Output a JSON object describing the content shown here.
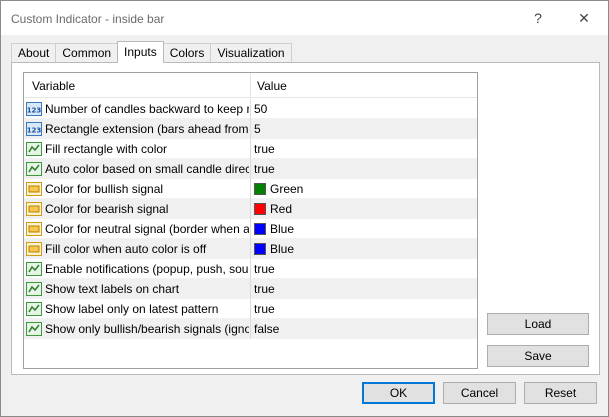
{
  "window": {
    "title": "Custom Indicator - inside bar",
    "help_glyph": "?",
    "close_glyph": "✕"
  },
  "tabs": [
    {
      "label": "About"
    },
    {
      "label": "Common"
    },
    {
      "label": "Inputs",
      "active": true
    },
    {
      "label": "Colors"
    },
    {
      "label": "Visualization"
    }
  ],
  "grid": {
    "columns": {
      "variable": "Variable",
      "value": "Value"
    },
    "rows": [
      {
        "icon": "number-icon",
        "name": "Number of candles backward to keep re...",
        "value": "50"
      },
      {
        "icon": "number-icon",
        "name": "Rectangle extension (bars ahead from bi...",
        "value": "5"
      },
      {
        "icon": "boolean-icon",
        "name": "Fill rectangle with color",
        "value": "true"
      },
      {
        "icon": "boolean-icon",
        "name": "Auto color based on small candle direction",
        "value": "true"
      },
      {
        "icon": "color-icon",
        "name": "Color for bullish signal",
        "value": "Green",
        "swatch": "#008000"
      },
      {
        "icon": "color-icon",
        "name": "Color for bearish signal",
        "value": "Red",
        "swatch": "#ff0000"
      },
      {
        "icon": "color-icon",
        "name": "Color for neutral signal (border when aut...",
        "value": "Blue",
        "swatch": "#0000ff"
      },
      {
        "icon": "color-icon",
        "name": "Fill color when auto color is off",
        "value": "Blue",
        "swatch": "#0000ff"
      },
      {
        "icon": "boolean-icon",
        "name": "Enable notifications (popup, push, sound)",
        "value": "true"
      },
      {
        "icon": "boolean-icon",
        "name": "Show text labels on chart",
        "value": "true"
      },
      {
        "icon": "boolean-icon",
        "name": "Show label only on latest pattern",
        "value": "true"
      },
      {
        "icon": "boolean-icon",
        "name": "Show only bullish/bearish signals (ignore...",
        "value": "false"
      }
    ]
  },
  "side_buttons": {
    "load": "Load",
    "save": "Save"
  },
  "footer": {
    "ok": "OK",
    "cancel": "Cancel",
    "reset": "Reset"
  }
}
